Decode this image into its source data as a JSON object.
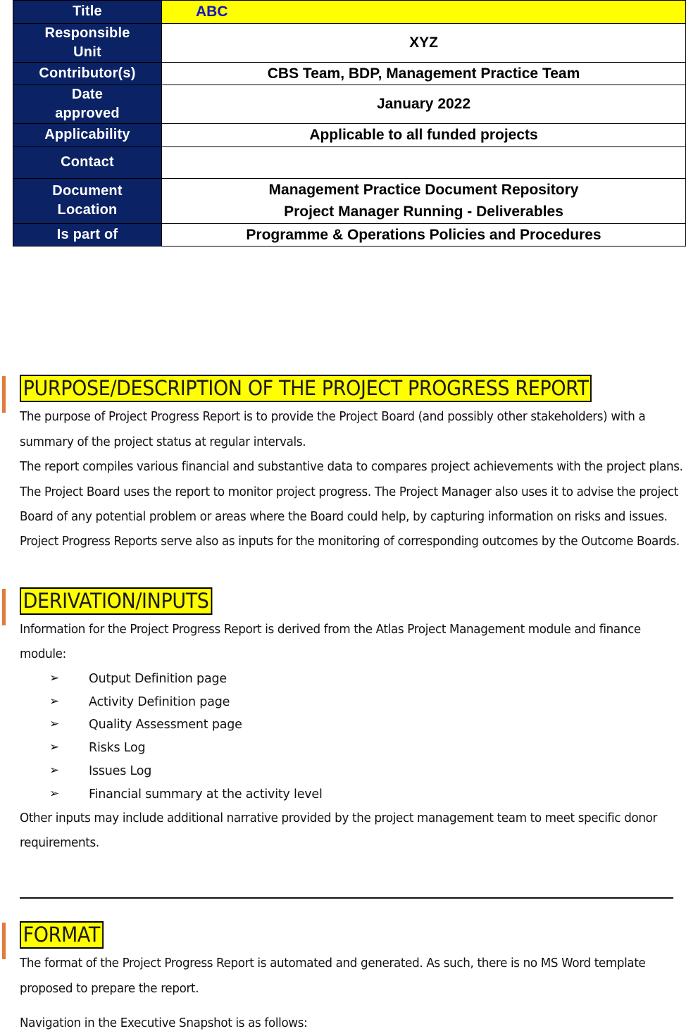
{
  "meta_table": {
    "rows": [
      {
        "label_lines": [
          "Title"
        ],
        "value_lines": [
          "ABC"
        ],
        "style": "title"
      },
      {
        "label_lines": [
          "Responsible",
          "Unit"
        ],
        "value_lines": [
          "XYZ"
        ],
        "style": "normal"
      },
      {
        "label_lines": [
          "Contributor(s)"
        ],
        "value_lines": [
          "CBS Team, BDP, Management Practice Team"
        ],
        "style": "normal"
      },
      {
        "label_lines": [
          "Date",
          "approved"
        ],
        "value_lines": [
          "January 2022"
        ],
        "style": "normal"
      },
      {
        "label_lines": [
          "Applicability"
        ],
        "value_lines": [
          "Applicable to all funded projects"
        ],
        "style": "normal"
      },
      {
        "label_lines": [
          "Contact"
        ],
        "value_lines": [
          ""
        ],
        "style": "empty"
      },
      {
        "label_lines": [
          "Document",
          "Location"
        ],
        "value_lines": [
          "Management Practice Document Repository",
          "Project Manager  Running - Deliverables"
        ],
        "style": "normal"
      },
      {
        "label_lines": [
          "Is part of"
        ],
        "value_lines": [
          "Programme & Operations Policies and Procedures"
        ],
        "style": "normal"
      }
    ]
  },
  "sections": {
    "purpose": {
      "heading": "PURPOSE/DESCRIPTION OF THE PROJECT PROGRESS REPORT",
      "paragraph_1": "The purpose of Project Progress Report is to provide the Project Board (and possibly other stakeholders) with a summary of the project status at regular intervals.",
      "paragraph_2": "The report compiles various financial and substantive data to compares project achievements with the project plans. The Project Board uses the report to monitor project progress. The Project Manager also uses it to advise the project Board of any potential problem or areas where the Board could help, by capturing information on risks and issues. Project Progress Reports serve also as inputs for the monitoring of corresponding outcomes by the Outcome Boards."
    },
    "derivation": {
      "heading": "DERIVATION/INPUTS",
      "intro": "Information for the Project Progress Report is derived from the Atlas Project Management module and finance module:",
      "bullet_glyph": "➢",
      "items": [
        "Output Definition page",
        "Activity Definition page",
        "Quality Assessment page",
        "Risks Log",
        "Issues Log",
        "Financial summary at the activity level"
      ],
      "closing": "Other inputs may include additional narrative provided by the project management team to meet specific donor requirements."
    },
    "format": {
      "heading": "FORMAT",
      "paragraph_1": "The format of the Project Progress Report is automated and generated. As such, there is no MS Word template proposed to prepare the report.",
      "paragraph_2": "Navigation in the Executive Snapshot is as follows:"
    }
  },
  "colors": {
    "table_header_navy": "#0B2265",
    "highlight_yellow": "#FFFF00",
    "title_value_blue": "#1414C8",
    "change_bar_orange": "#E07B39"
  }
}
